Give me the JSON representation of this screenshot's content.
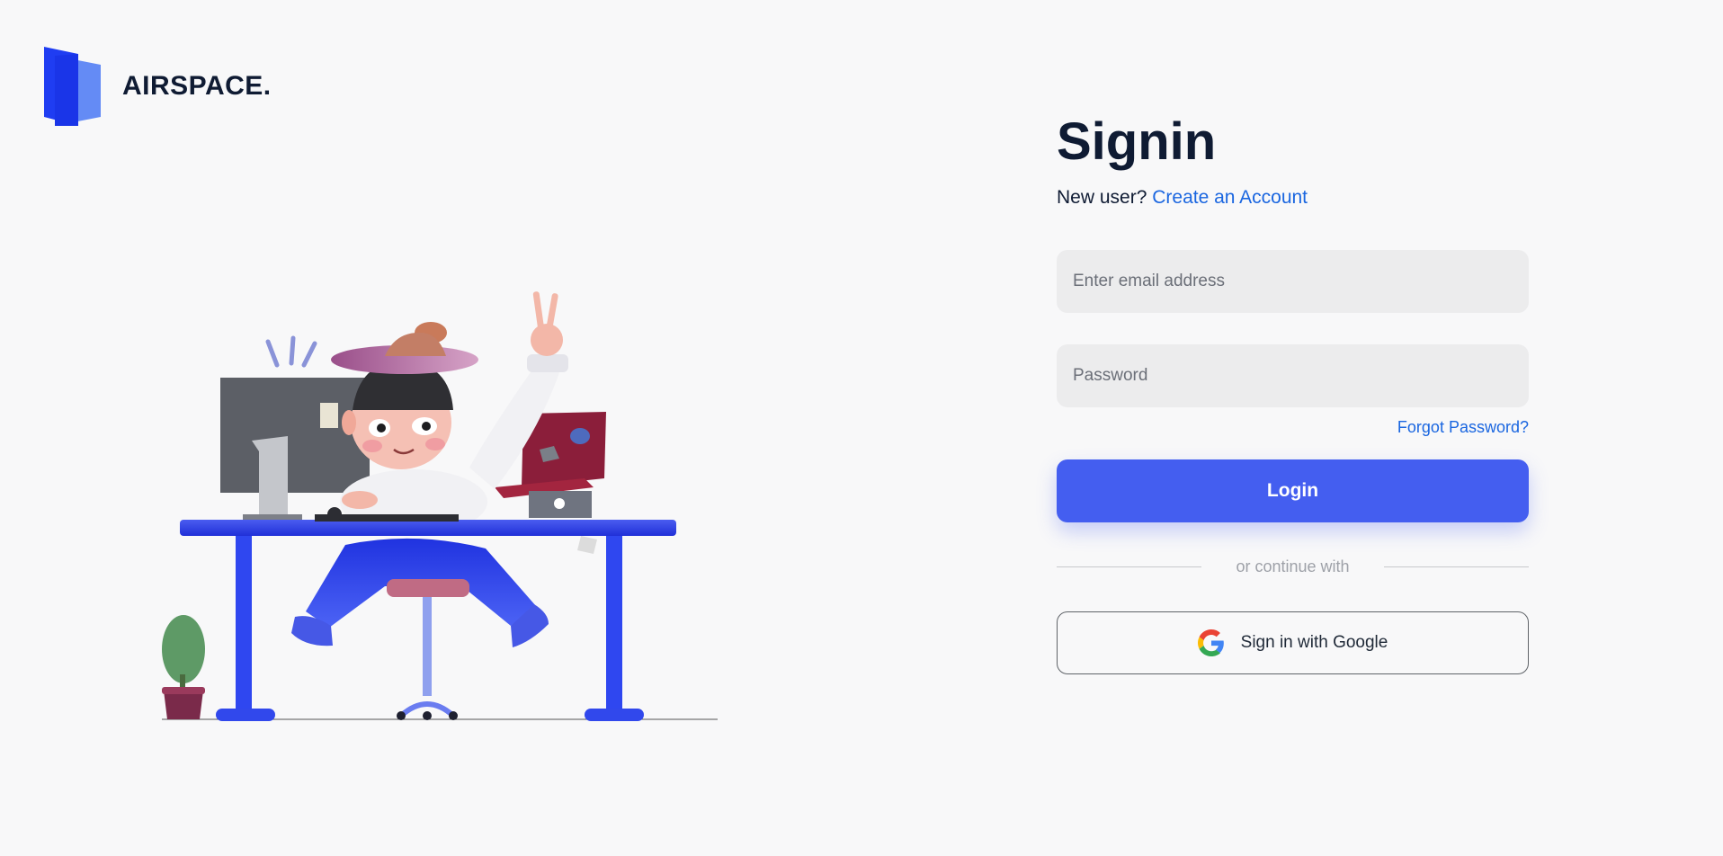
{
  "brand": {
    "name": "AIRSPACE.",
    "logo_icon": "airspace-logo-icon"
  },
  "illustration": {
    "icon": "person-at-desk-illustration"
  },
  "signin": {
    "title": "Signin",
    "new_user_text": "New user?",
    "create_account_link": "Create an Account",
    "email_placeholder": "Enter email address",
    "password_placeholder": "Password",
    "forgot_password_link": "Forgot Password?",
    "login_button": "Login",
    "divider_text": "or continue with",
    "google_button": "Sign in with Google",
    "google_icon": "google-icon"
  },
  "colors": {
    "background": "#f8f8f9",
    "primary": "#445ef0",
    "link": "#1a66e0",
    "text": "#0f1b33",
    "field_bg": "#ececed"
  }
}
